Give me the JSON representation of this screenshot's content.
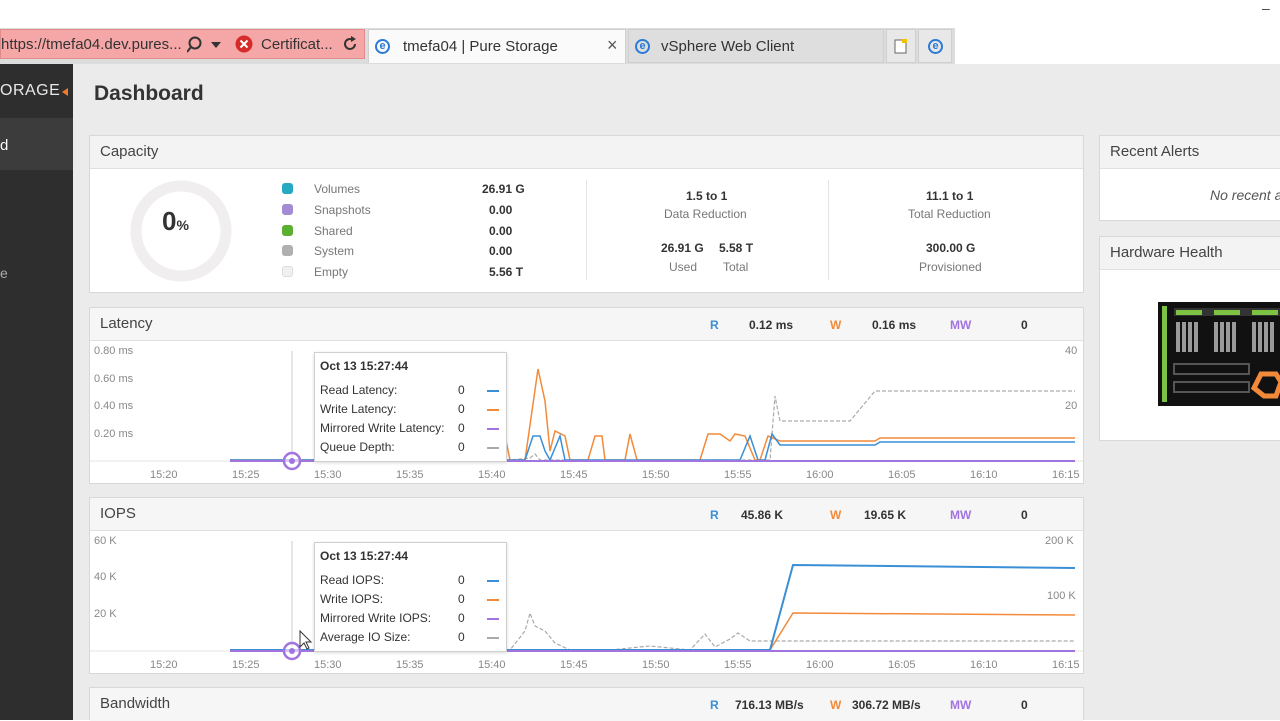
{
  "browser": {
    "address_url": "https://tmefa04.dev.pures...",
    "address_cert": "Certificat...",
    "tabs": [
      {
        "label": "tmefa04 | Pure Storage",
        "close": "×"
      },
      {
        "label": "vSphere Web Client"
      }
    ]
  },
  "sidebar": {
    "logo": "ORAGE",
    "active_item": "d",
    "item2": "e"
  },
  "page": {
    "title": "Dashboard"
  },
  "capacity": {
    "title": "Capacity",
    "percent": "0",
    "percent_unit": "%",
    "legend": [
      {
        "label": "Volumes",
        "value": "26.91 G",
        "color": "#27a9c4"
      },
      {
        "label": "Snapshots",
        "value": "0.00",
        "color": "#a58ad6"
      },
      {
        "label": "Shared",
        "value": "0.00",
        "color": "#5cb030"
      },
      {
        "label": "System",
        "value": "0.00",
        "color": "#b0b0b0"
      },
      {
        "label": "Empty",
        "value": "5.56 T",
        "color": "#f0f0f0"
      }
    ],
    "data_reduction": "1.5 to 1",
    "data_reduction_label": "Data Reduction",
    "used": "26.91 G",
    "used_label": "Used",
    "total": "5.58 T",
    "total_label": "Total",
    "total_reduction": "11.1 to 1",
    "total_reduction_label": "Total Reduction",
    "provisioned": "300.00 G",
    "provisioned_label": "Provisioned"
  },
  "latency": {
    "title": "Latency",
    "r_label": "R",
    "r_value": "0.12 ms",
    "w_label": "W",
    "w_value": "0.16 ms",
    "mw_label": "MW",
    "mw_value": "0",
    "y_ticks": [
      "0.80 ms",
      "0.60 ms",
      "0.40 ms",
      "0.20 ms"
    ],
    "y2_ticks": [
      "40",
      "20"
    ],
    "tooltip": {
      "time": "Oct 13 15:27:44",
      "rows": [
        {
          "label": "Read Latency:",
          "value": "0"
        },
        {
          "label": "Write Latency:",
          "value": "0"
        },
        {
          "label": "Mirrored Write Latency:",
          "value": "0"
        },
        {
          "label": "Queue Depth:",
          "value": "0"
        }
      ]
    }
  },
  "iops": {
    "title": "IOPS",
    "r_label": "R",
    "r_value": "45.86 K",
    "w_label": "W",
    "w_value": "19.65 K",
    "mw_label": "MW",
    "mw_value": "0",
    "y_ticks": [
      "60 K",
      "40 K",
      "20 K"
    ],
    "y2_ticks": [
      "200 K",
      "100 K"
    ],
    "tooltip": {
      "time": "Oct 13 15:27:44",
      "rows": [
        {
          "label": "Read IOPS:",
          "value": "0"
        },
        {
          "label": "Write IOPS:",
          "value": "0"
        },
        {
          "label": "Mirrored Write IOPS:",
          "value": "0"
        },
        {
          "label": "Average IO Size:",
          "value": "0"
        }
      ]
    }
  },
  "x_ticks": [
    "15:20",
    "15:25",
    "15:30",
    "15:35",
    "15:40",
    "15:45",
    "15:50",
    "15:55",
    "16:00",
    "16:05",
    "16:10",
    "16:15"
  ],
  "bandwidth": {
    "title": "Bandwidth",
    "r_label": "R",
    "r_value": "716.13 MB/s",
    "w_label": "W",
    "w_value": "306.72 MB/s",
    "mw_label": "MW",
    "mw_value": "0"
  },
  "alerts": {
    "title": "Recent Alerts",
    "empty_text": "No recent a"
  },
  "hardware": {
    "title": "Hardware Health"
  },
  "colors": {
    "read": "#3a8fd6",
    "write": "#f28a3a",
    "mirrored": "#a274e0",
    "queue": "#aaaaaa"
  }
}
